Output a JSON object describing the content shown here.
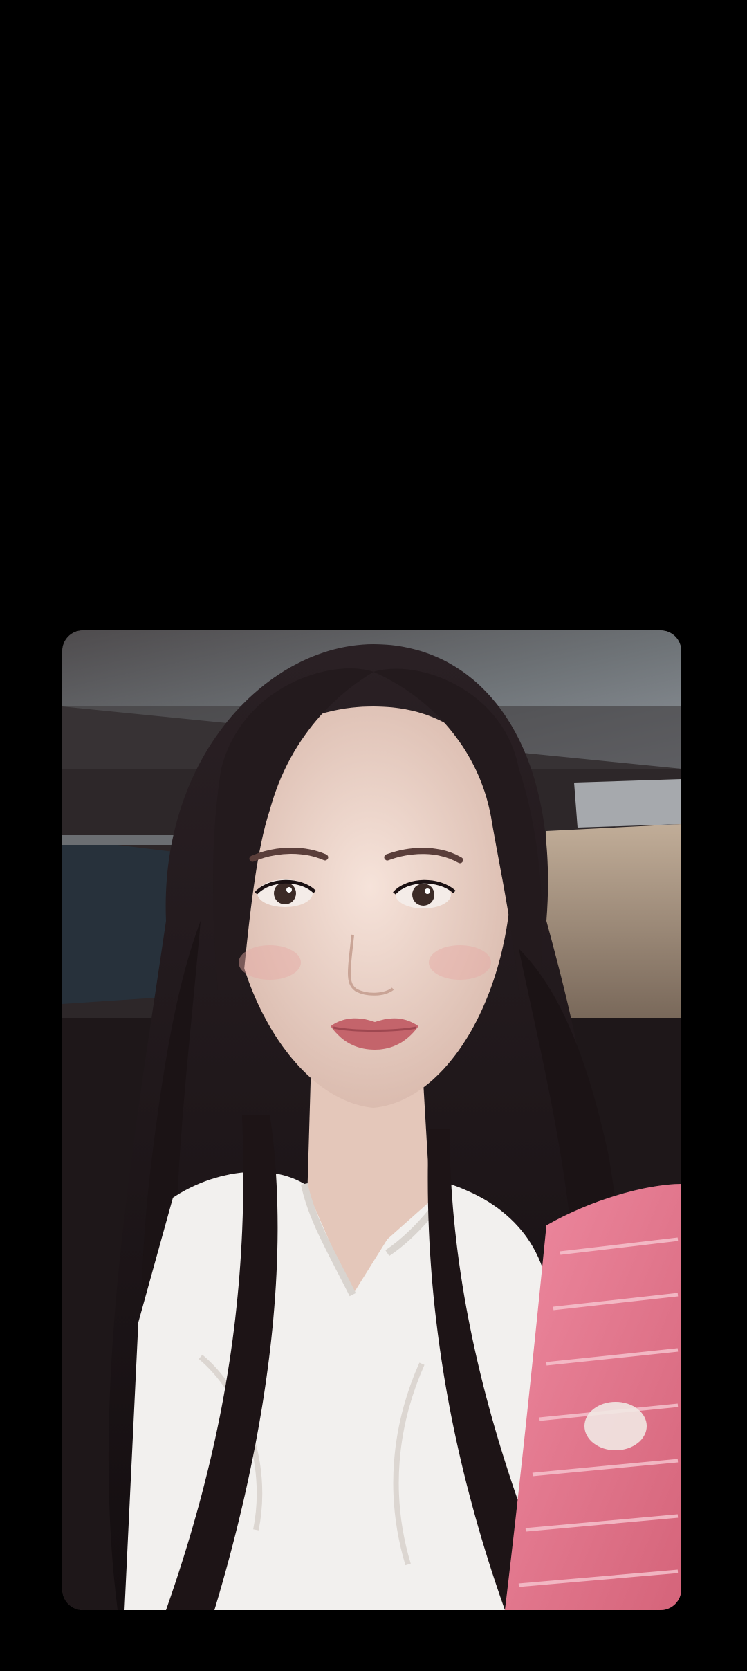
{
  "viewer": {
    "background_color": "#000000",
    "content_type": "photo"
  },
  "photo": {
    "palette": {
      "ceiling": "#5f5c5f",
      "ceiling_light": "#8a8f96",
      "window": "#2a3440",
      "wall": "#b09a86",
      "hair": "#1f1618",
      "skin": "#efd9cf",
      "lips": "#c4646b",
      "blouse": "#f2f0ee",
      "cardigan": "#e57b8f"
    }
  }
}
